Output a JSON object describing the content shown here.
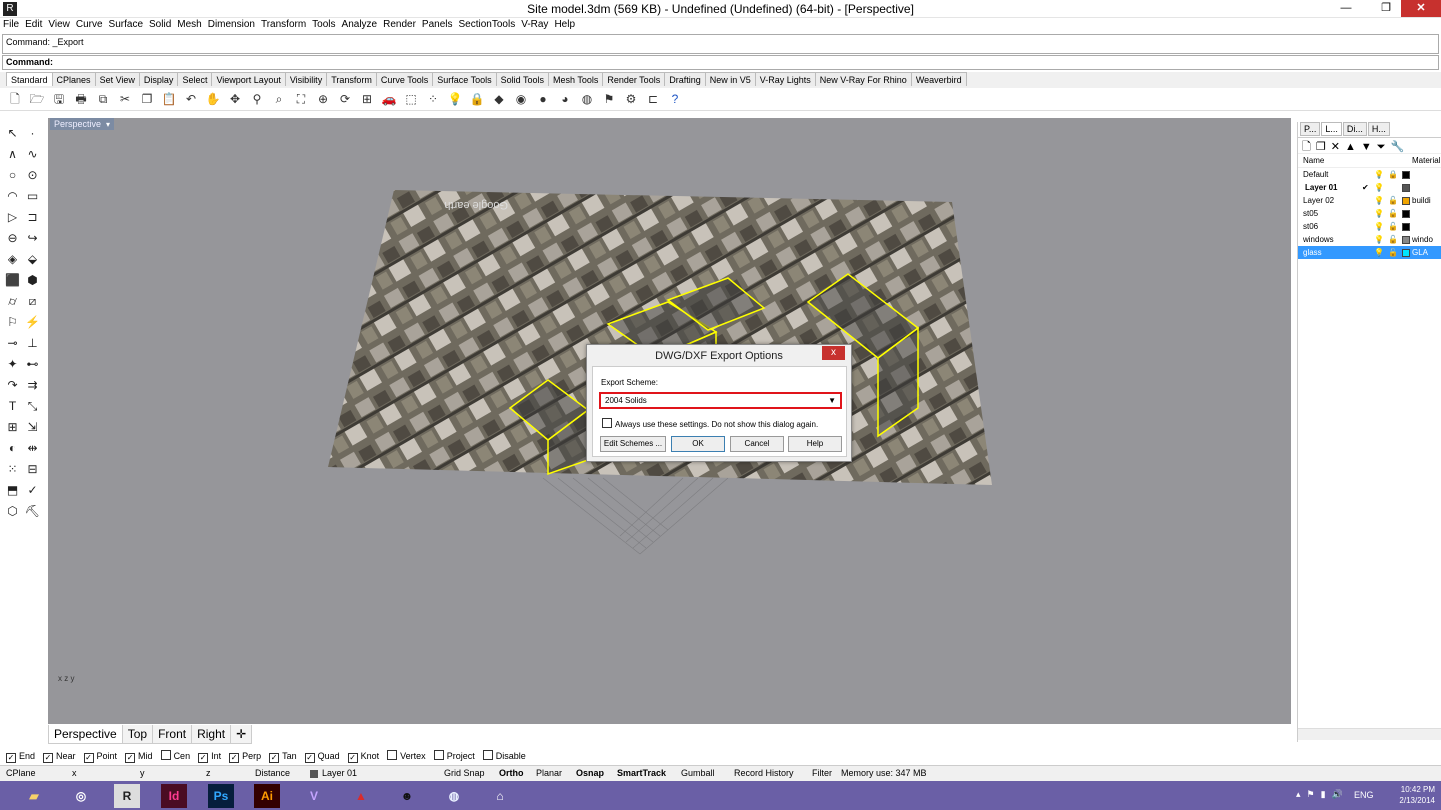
{
  "window": {
    "title": "Site model.3dm (569 KB) - Undefined (Undefined) (64-bit) - [Perspective]"
  },
  "menu": [
    "File",
    "Edit",
    "View",
    "Curve",
    "Surface",
    "Solid",
    "Mesh",
    "Dimension",
    "Transform",
    "Tools",
    "Analyze",
    "Render",
    "Panels",
    "SectionTools",
    "V-Ray",
    "Help"
  ],
  "command": {
    "history": "Command: _Export",
    "prompt": "Command:"
  },
  "toolbar_tabs": [
    "Standard",
    "CPlanes",
    "Set View",
    "Display",
    "Select",
    "Viewport Layout",
    "Visibility",
    "Transform",
    "Curve Tools",
    "Surface Tools",
    "Solid Tools",
    "Mesh Tools",
    "Render Tools",
    "Drafting",
    "New in V5",
    "V-Ray Lights",
    "New V-Ray For Rhino",
    "Weaverbird"
  ],
  "viewport": {
    "label": "Perspective",
    "watermark": "Google earth",
    "axes": "x z y"
  },
  "view_tabs": [
    "Perspective",
    "Top",
    "Front",
    "Right"
  ],
  "panel": {
    "tabs": [
      "P...",
      "L...",
      "Di...",
      "H..."
    ],
    "col_name": "Name",
    "col_material": "Material",
    "layers": [
      {
        "name": "Default",
        "current": "",
        "lock": "🔒",
        "color": "#000000",
        "material": "",
        "selected": false,
        "bold": false
      },
      {
        "name": "Layer 01",
        "current": "✔",
        "lock": "",
        "color": "#555555",
        "material": "",
        "selected": false,
        "bold": true
      },
      {
        "name": "Layer 02",
        "current": "",
        "lock": "🔓",
        "color": "#f0a500",
        "material": "buildi",
        "selected": false,
        "bold": false
      },
      {
        "name": "st05",
        "current": "",
        "lock": "🔓",
        "color": "#000000",
        "material": "",
        "selected": false,
        "bold": false
      },
      {
        "name": "st06",
        "current": "",
        "lock": "🔓",
        "color": "#000000",
        "material": "",
        "selected": false,
        "bold": false
      },
      {
        "name": "windows",
        "current": "",
        "lock": "🔓",
        "color": "#888888",
        "material": "windo",
        "selected": false,
        "bold": false
      },
      {
        "name": "glass",
        "current": "",
        "lock": "🔓",
        "color": "#00e5ff",
        "material": "GLA",
        "selected": true,
        "bold": false
      }
    ]
  },
  "dialog": {
    "title": "DWG/DXF Export Options",
    "close": "x",
    "scheme_label": "Export Scheme:",
    "scheme_value": "2004 Solids",
    "always_label": "Always use these settings. Do not show this dialog again.",
    "buttons": {
      "edit": "Edit Schemes ...",
      "ok": "OK",
      "cancel": "Cancel",
      "help": "Help"
    }
  },
  "osnaps": [
    {
      "label": "End",
      "checked": true
    },
    {
      "label": "Near",
      "checked": true
    },
    {
      "label": "Point",
      "checked": true
    },
    {
      "label": "Mid",
      "checked": true
    },
    {
      "label": "Cen",
      "checked": false
    },
    {
      "label": "Int",
      "checked": true
    },
    {
      "label": "Perp",
      "checked": true
    },
    {
      "label": "Tan",
      "checked": true
    },
    {
      "label": "Quad",
      "checked": true
    },
    {
      "label": "Knot",
      "checked": true
    },
    {
      "label": "Vertex",
      "checked": false
    },
    {
      "label": "Project",
      "checked": false
    },
    {
      "label": "Disable",
      "checked": false
    }
  ],
  "status": {
    "cplane": "CPlane",
    "x": "x",
    "y": "y",
    "z": "z",
    "distance": "Distance",
    "layer": "Layer 01",
    "grid_snap": "Grid Snap",
    "ortho": "Ortho",
    "planar": "Planar",
    "osnap": "Osnap",
    "smarttrack": "SmartTrack",
    "gumball": "Gumball",
    "record_history": "Record History",
    "filter": "Filter",
    "memory": "Memory use: 347 MB"
  },
  "taskbar": {
    "time": "10:42 PM",
    "date": "2/13/2014",
    "lang": "ENG"
  },
  "colors": {
    "viewport_bg": "#96969a",
    "taskbar": "#6a5fa6",
    "highlight": "#e0141a",
    "selection": "#3399ff",
    "wire": "#ffff00"
  }
}
